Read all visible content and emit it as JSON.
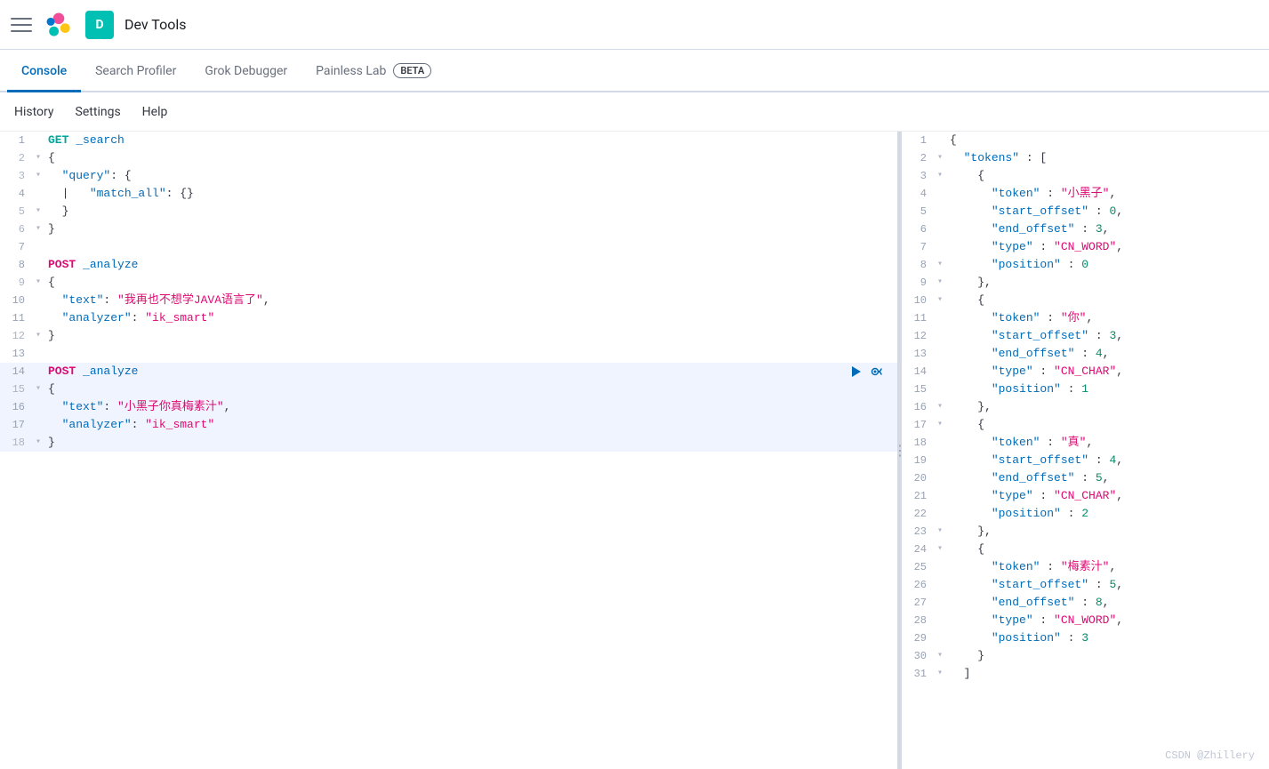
{
  "topbar": {
    "app_title": "Dev Tools",
    "user_initial": "D"
  },
  "nav": {
    "tabs": [
      {
        "label": "Console",
        "active": true
      },
      {
        "label": "Search Profiler",
        "active": false
      },
      {
        "label": "Grok Debugger",
        "active": false
      },
      {
        "label": "Painless Lab",
        "active": false,
        "badge": "BETA"
      }
    ]
  },
  "subtoolbar": {
    "items": [
      "History",
      "Settings",
      "Help"
    ]
  },
  "editor": {
    "lines": [
      {
        "num": "1",
        "fold": false,
        "content": "GET _search",
        "type": "request_get"
      },
      {
        "num": "2",
        "fold": true,
        "content": "{",
        "type": "brace"
      },
      {
        "num": "3",
        "fold": true,
        "content": "  \"query\": {",
        "type": "key_obj"
      },
      {
        "num": "4",
        "fold": false,
        "content": "  |   \"match_all\": {}",
        "type": "nested"
      },
      {
        "num": "5",
        "fold": true,
        "content": "  }",
        "type": "close"
      },
      {
        "num": "6",
        "fold": true,
        "content": "}",
        "type": "close"
      },
      {
        "num": "7",
        "fold": false,
        "content": "",
        "type": "empty"
      },
      {
        "num": "8",
        "fold": false,
        "content": "POST _analyze",
        "type": "request_post"
      },
      {
        "num": "9",
        "fold": true,
        "content": "{",
        "type": "brace"
      },
      {
        "num": "10",
        "fold": false,
        "content": "  \"text\": \"我再也不想学JAVA语言了\",",
        "type": "key_str"
      },
      {
        "num": "11",
        "fold": false,
        "content": "  \"analyzer\": \"ik_smart\"",
        "type": "key_str"
      },
      {
        "num": "12",
        "fold": true,
        "content": "}",
        "type": "close"
      },
      {
        "num": "13",
        "fold": false,
        "content": "",
        "type": "empty"
      },
      {
        "num": "14",
        "fold": false,
        "content": "POST _analyze",
        "type": "request_post",
        "highlighted": true,
        "actions": true
      },
      {
        "num": "15",
        "fold": true,
        "content": "{",
        "type": "brace",
        "highlighted": true
      },
      {
        "num": "16",
        "fold": false,
        "content": "  \"text\": \"小黑子你真梅素汁\",",
        "type": "key_str",
        "highlighted": true
      },
      {
        "num": "17",
        "fold": false,
        "content": "  \"analyzer\": \"ik_smart\"",
        "type": "key_str",
        "highlighted": true
      },
      {
        "num": "18",
        "fold": true,
        "content": "}",
        "type": "close",
        "highlighted": true
      }
    ]
  },
  "output": {
    "lines": [
      {
        "num": "1",
        "fold": false,
        "content": "{"
      },
      {
        "num": "2",
        "fold": true,
        "content": "  \"tokens\" : ["
      },
      {
        "num": "3",
        "fold": true,
        "content": "    {"
      },
      {
        "num": "4",
        "fold": false,
        "content": "      \"token\" : \"小黑子\","
      },
      {
        "num": "5",
        "fold": false,
        "content": "      \"start_offset\" : 0,"
      },
      {
        "num": "6",
        "fold": false,
        "content": "      \"end_offset\" : 3,"
      },
      {
        "num": "7",
        "fold": false,
        "content": "      \"type\" : \"CN_WORD\","
      },
      {
        "num": "8",
        "fold": false,
        "content": "      \"position\" : 0"
      },
      {
        "num": "9",
        "fold": true,
        "content": "    },"
      },
      {
        "num": "10",
        "fold": true,
        "content": "    {"
      },
      {
        "num": "11",
        "fold": false,
        "content": "      \"token\" : \"你\","
      },
      {
        "num": "12",
        "fold": false,
        "content": "      \"start_offset\" : 3,"
      },
      {
        "num": "13",
        "fold": false,
        "content": "      \"end_offset\" : 4,"
      },
      {
        "num": "14",
        "fold": false,
        "content": "      \"type\" : \"CN_CHAR\","
      },
      {
        "num": "15",
        "fold": false,
        "content": "      \"position\" : 1"
      },
      {
        "num": "16",
        "fold": true,
        "content": "    },"
      },
      {
        "num": "17",
        "fold": true,
        "content": "    {"
      },
      {
        "num": "18",
        "fold": false,
        "content": "      \"token\" : \"真\","
      },
      {
        "num": "19",
        "fold": false,
        "content": "      \"start_offset\" : 4,"
      },
      {
        "num": "20",
        "fold": false,
        "content": "      \"end_offset\" : 5,"
      },
      {
        "num": "21",
        "fold": false,
        "content": "      \"type\" : \"CN_CHAR\","
      },
      {
        "num": "22",
        "fold": false,
        "content": "      \"position\" : 2"
      },
      {
        "num": "23",
        "fold": true,
        "content": "    },"
      },
      {
        "num": "24",
        "fold": true,
        "content": "    {"
      },
      {
        "num": "25",
        "fold": false,
        "content": "      \"token\" : \"梅素汁\","
      },
      {
        "num": "26",
        "fold": false,
        "content": "      \"start_offset\" : 5,"
      },
      {
        "num": "27",
        "fold": false,
        "content": "      \"end_offset\" : 8,"
      },
      {
        "num": "28",
        "fold": false,
        "content": "      \"type\" : \"CN_WORD\","
      },
      {
        "num": "29",
        "fold": false,
        "content": "      \"position\" : 3"
      },
      {
        "num": "30",
        "fold": true,
        "content": "    }"
      },
      {
        "num": "31",
        "fold": true,
        "content": "  ]"
      }
    ]
  },
  "watermark": "CSDN @Zhillery"
}
